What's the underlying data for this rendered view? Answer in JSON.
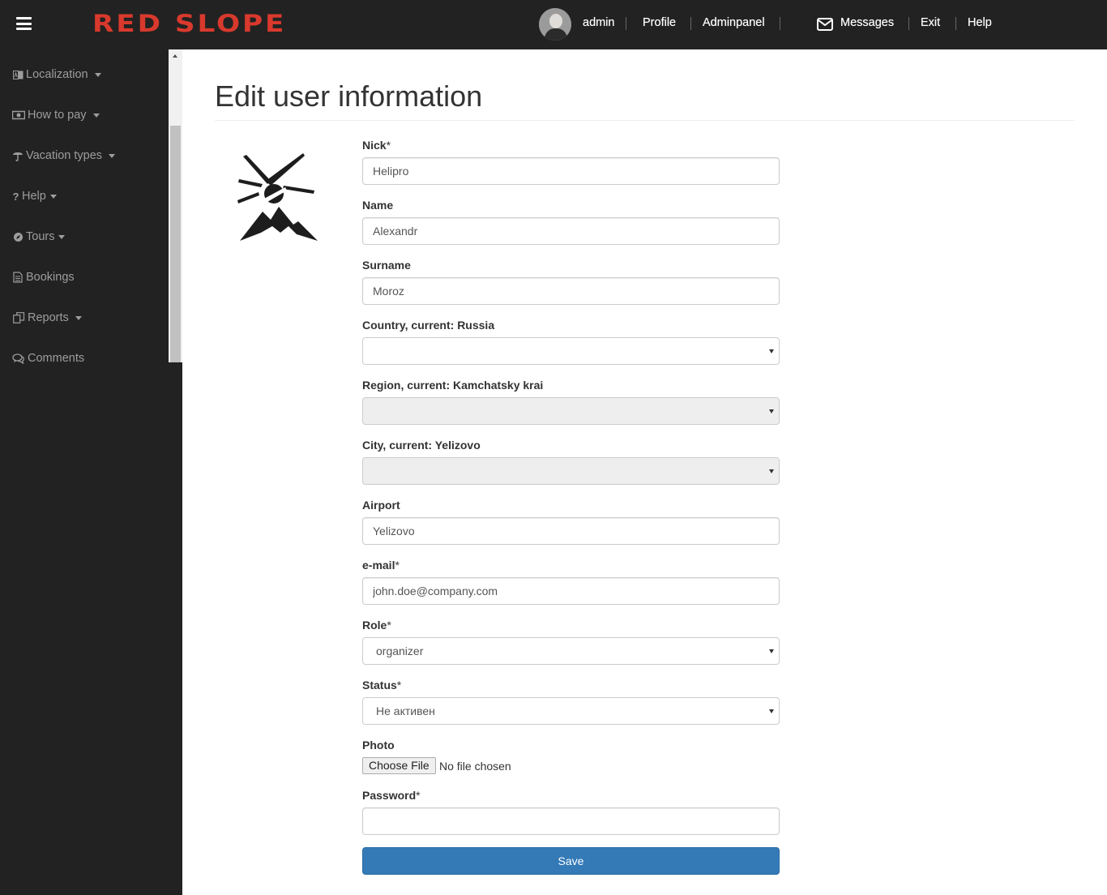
{
  "header": {
    "brand": "RED SLOPE",
    "user_name": "admin",
    "links": {
      "profile": "Profile",
      "adminpanel": "Adminpanel",
      "messages": "Messages",
      "exit": "Exit",
      "help": "Help"
    }
  },
  "sidebar": {
    "items": [
      {
        "label": "Localization",
        "icon": "language-icon",
        "dropdown": true
      },
      {
        "label": "How to pay",
        "icon": "money-icon",
        "dropdown": true
      },
      {
        "label": "Vacation types",
        "icon": "umbrella-icon",
        "dropdown": true
      },
      {
        "label": "Help",
        "icon": "question-icon",
        "dropdown": true
      },
      {
        "label": "Tours",
        "icon": "compass-icon",
        "dropdown": true
      },
      {
        "label": "Bookings",
        "icon": "document-icon",
        "dropdown": false
      },
      {
        "label": "Reports",
        "icon": "copy-icon",
        "dropdown": true
      },
      {
        "label": "Comments",
        "icon": "comments-icon",
        "dropdown": false
      }
    ]
  },
  "page": {
    "title": "Edit user information"
  },
  "form": {
    "nick": {
      "label": "Nick",
      "required_mark": "*",
      "value": "Helipro"
    },
    "name": {
      "label": "Name",
      "value": "Alexandr"
    },
    "surname": {
      "label": "Surname",
      "value": "Moroz"
    },
    "country": {
      "label": "Country, current: Russia",
      "value": ""
    },
    "region": {
      "label": "Region, current: Kamchatsky krai",
      "value": ""
    },
    "city": {
      "label": "City, current: Yelizovo",
      "value": ""
    },
    "airport": {
      "label": "Airport",
      "value": "Yelizovo"
    },
    "email": {
      "label": "e-mail",
      "required_mark": "*",
      "value": "john.doe@company.com"
    },
    "role": {
      "label": "Role",
      "required_mark": "*",
      "value": "organizer"
    },
    "status": {
      "label": "Status",
      "required_mark": "*",
      "value": "Не активен"
    },
    "photo": {
      "label": "Photo",
      "button": "Choose File",
      "status": "No file chosen"
    },
    "password": {
      "label": "Password",
      "required_mark": "*",
      "value": ""
    },
    "save_label": "Save"
  },
  "colors": {
    "brand": "#d9392d",
    "navbar_bg": "#222222",
    "primary_button": "#337ab7"
  }
}
